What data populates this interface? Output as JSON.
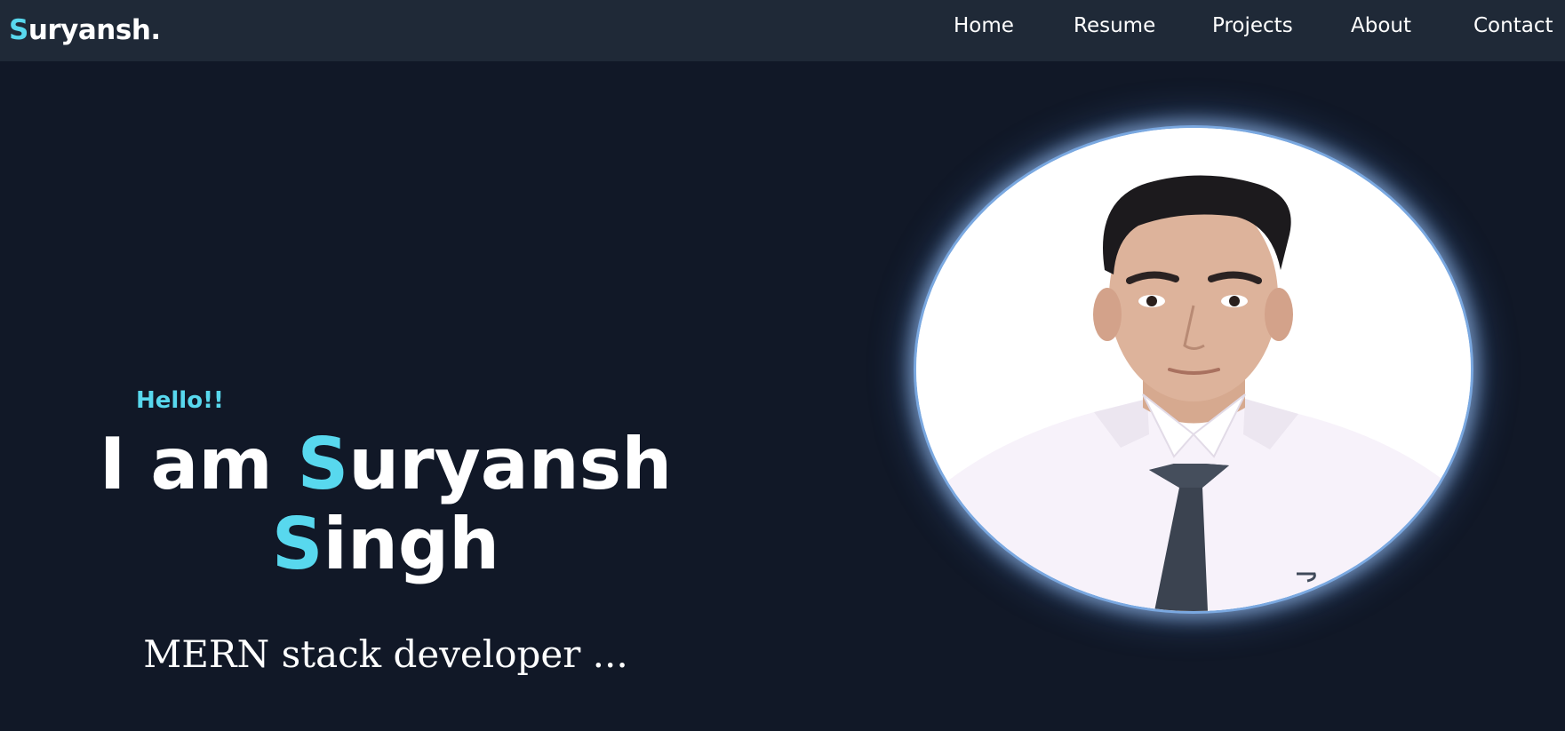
{
  "nav": {
    "logo_initial": "S",
    "logo_rest": "uryansh.",
    "links": [
      {
        "label": "Home"
      },
      {
        "label": "Resume"
      },
      {
        "label": "Projects"
      },
      {
        "label": "About"
      },
      {
        "label": "Contact"
      }
    ]
  },
  "hero": {
    "greeting": "Hello!!",
    "name_prefix": "I am ",
    "first_initial": "S",
    "first_rest": "uryansh",
    "last_initial": "S",
    "last_rest": "ingh",
    "role": "MERN stack developer ..."
  },
  "colors": {
    "background": "#111827",
    "navbar": "#1f2937",
    "accent": "#58d8ee",
    "text": "#ffffff"
  },
  "icons": {
    "profile_photo": "profile-photo"
  }
}
